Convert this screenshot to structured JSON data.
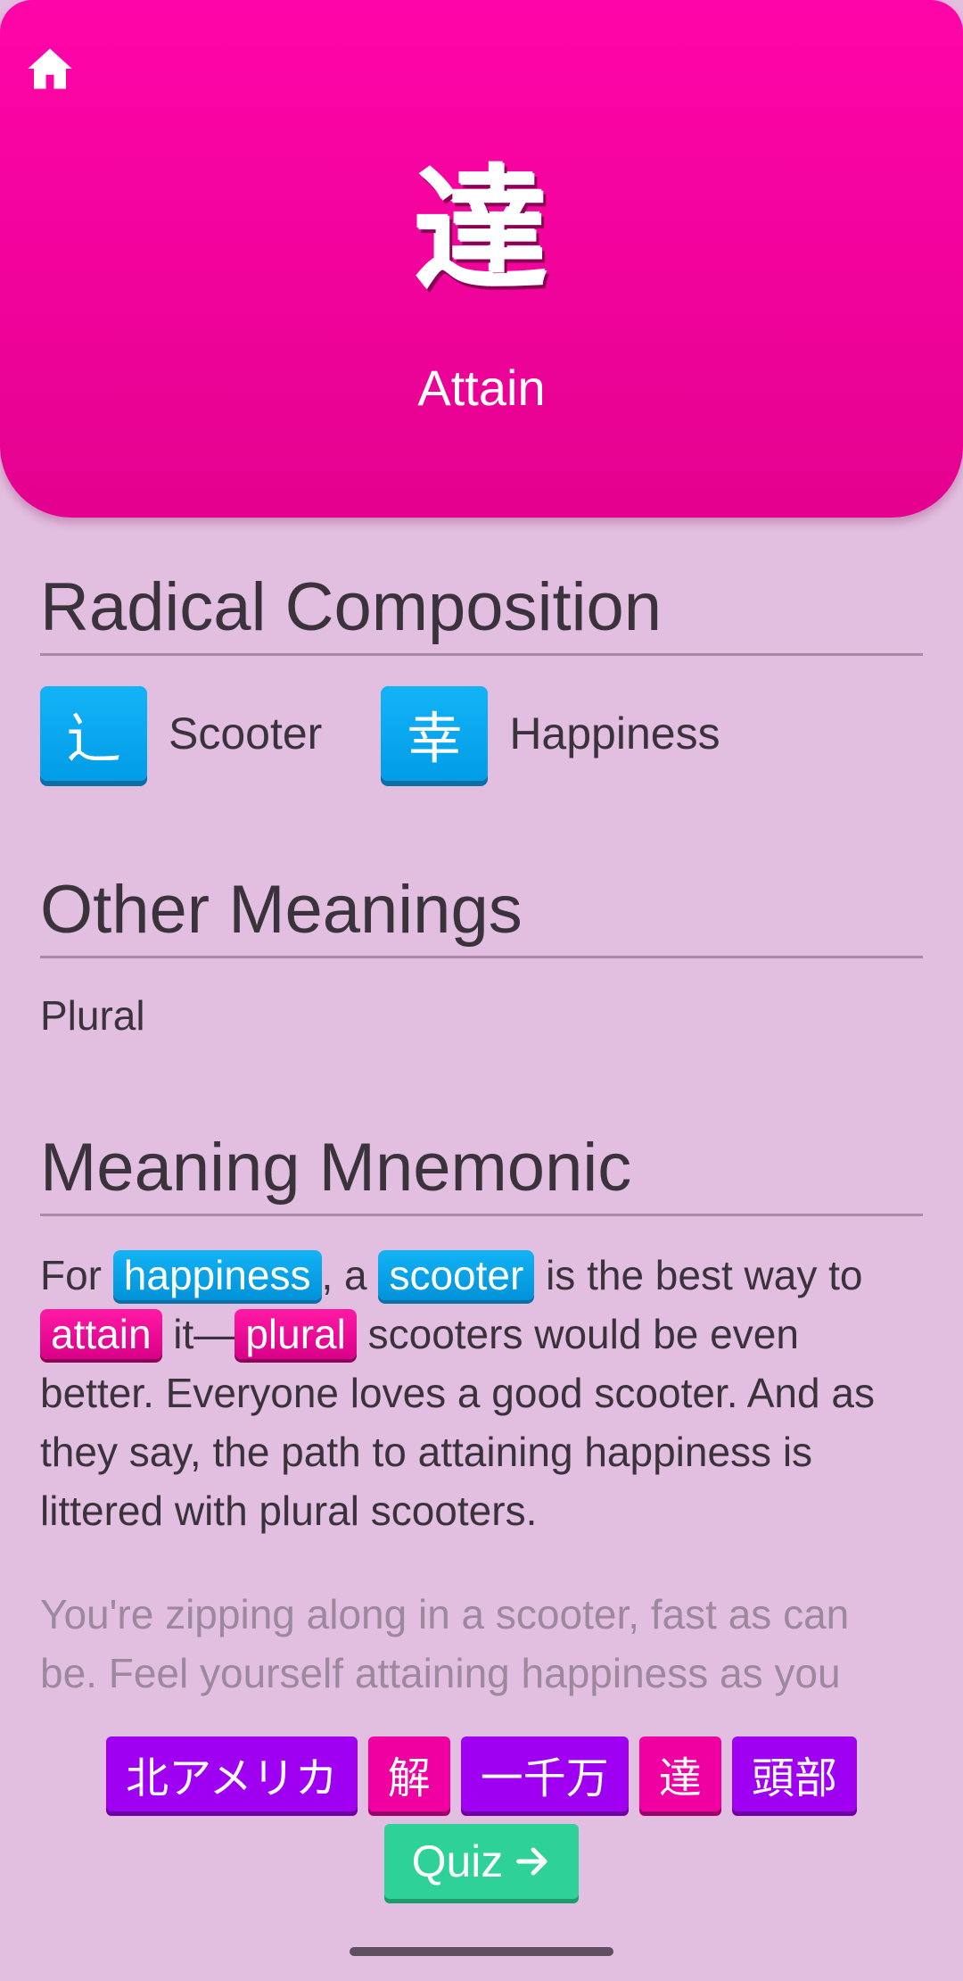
{
  "header": {
    "kanji": "達",
    "meaning": "Attain",
    "home_icon": "home-icon"
  },
  "sections": {
    "radical_title": "Radical Composition",
    "other_title": "Other Meanings",
    "mnemonic_title": "Meaning Mnemonic"
  },
  "radicals": [
    {
      "char": "辶",
      "name": "Scooter"
    },
    {
      "char": "幸",
      "name": "Happiness"
    }
  ],
  "other_meanings": "Plural",
  "mnemonic": {
    "p1": "For ",
    "t1": "happiness",
    "p2": ", a ",
    "t2": "scooter",
    "p3": " is the best way to ",
    "t3": "attain",
    "p4": " it—",
    "t4": "plural",
    "p5": " scooters would be even better. Everyone loves a good scooter. And as they say, the path to attaining happiness is littered with plural scooters.",
    "hint": "You're zipping along in a scooter, fast as can be. Feel yourself attaining happiness as you also follow a path leaves"
  },
  "related": [
    {
      "label": "北アメリカ",
      "kind": "vocab"
    },
    {
      "label": "解",
      "kind": "kanji"
    },
    {
      "label": "一千万",
      "kind": "vocab"
    },
    {
      "label": "達",
      "kind": "kanji"
    },
    {
      "label": "頭部",
      "kind": "vocab"
    }
  ],
  "quiz": {
    "label": "Quiz",
    "arrow_icon": "arrow-right-icon"
  },
  "colors": {
    "background": "#e2bee0",
    "header": "#ff05a9",
    "radical": "#019de8",
    "kanji": "#f000a1",
    "vocab": "#a000f1",
    "quiz": "#2ed197"
  }
}
